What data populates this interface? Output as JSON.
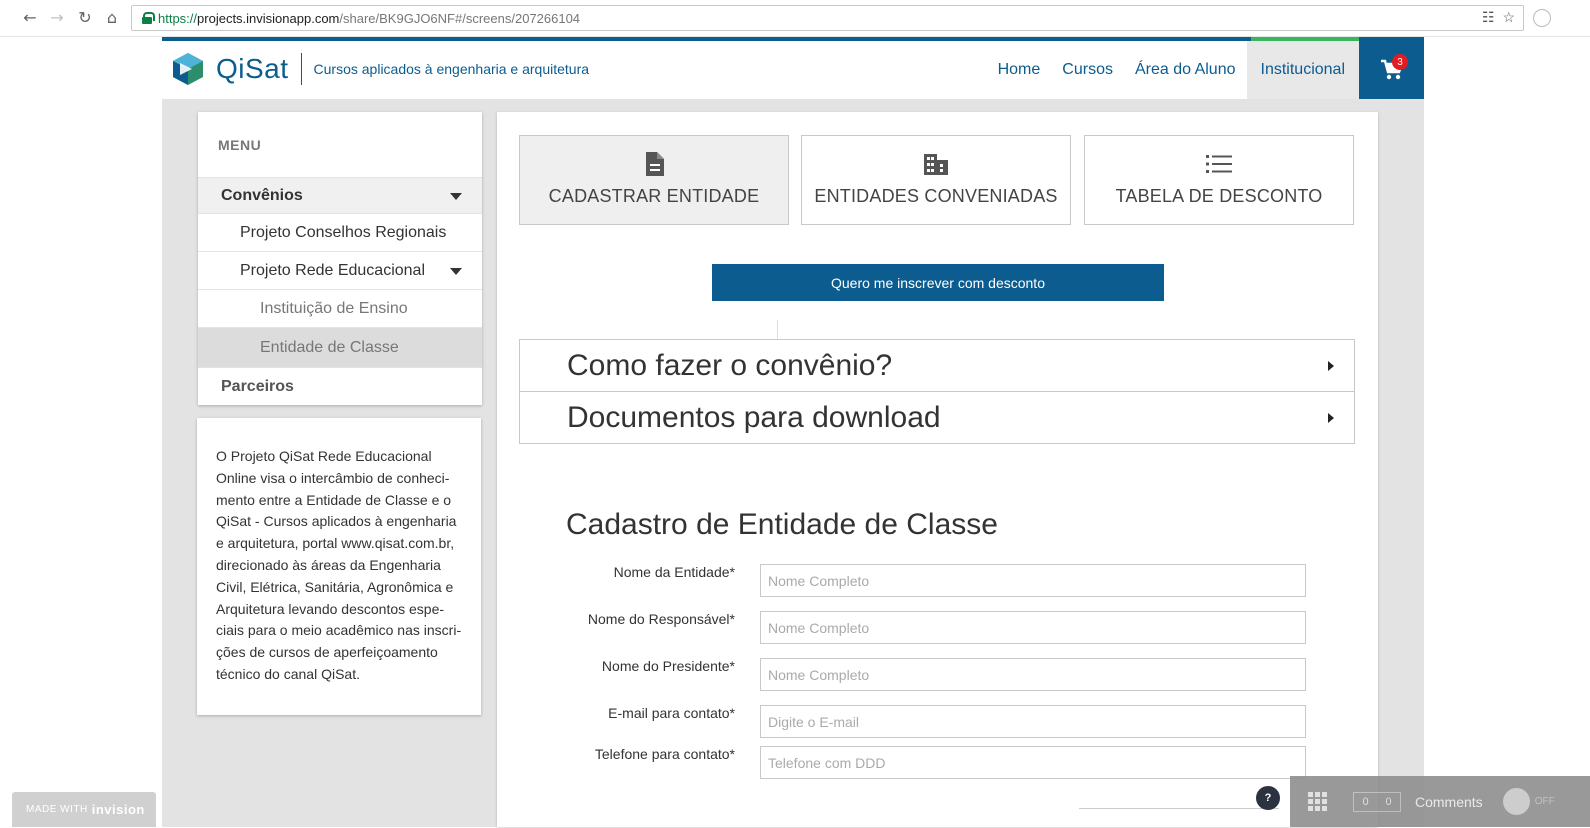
{
  "browser": {
    "url_protocol": "https://",
    "url_host": "projects.invisionapp.com",
    "url_path": "/share/BK9GJO6NF#/screens/207266104"
  },
  "header": {
    "logo_name": "QiSat",
    "tagline": "Cursos aplicados à engenharia e arquitetura",
    "nav": [
      {
        "label": "Home"
      },
      {
        "label": "Cursos"
      },
      {
        "label": "Área do Aluno"
      },
      {
        "label": "Institucional"
      }
    ],
    "cart_count": "3",
    "brand_color": "#0c5c8f",
    "accent_color": "#3bb55b"
  },
  "sidebar": {
    "menu_title": "MENU",
    "items": [
      {
        "label": "Convênios"
      },
      {
        "label": "Projeto Conselhos Regionais"
      },
      {
        "label": "Projeto Rede Educacional"
      },
      {
        "label": "Instituição de Ensino"
      },
      {
        "label": "Entidade de Classe"
      },
      {
        "label": "Parceiros"
      }
    ],
    "description": "O Projeto QiSat Rede Educacional Online visa o intercâmbio de conheci-mento entre a Entidade de Classe e o QiSat - Cursos aplicados à engenharia e arquitetura, portal www.qisat.com.br, direcionado às áreas da Engenharia Civil, Elétrica, Sanitária, Agronômica e Arquitetura levando descontos espe-ciais para o meio acadêmico nas inscri-ções de cursos de aperfeiçoamento técnico do canal QiSat."
  },
  "main": {
    "tiles": [
      {
        "label": "CADASTRAR ENTIDADE",
        "icon": "document-icon"
      },
      {
        "label": "ENTIDADES CONVENIADAS",
        "icon": "building-icon"
      },
      {
        "label": "TABELA DE DESCONTO",
        "icon": "list-icon"
      }
    ],
    "cta_label": "Quero me inscrever com desconto",
    "accordions": [
      {
        "label": "Como fazer o convênio?"
      },
      {
        "label": "Documentos para download"
      }
    ],
    "form": {
      "title": "Cadastro de Entidade de Classe",
      "fields": [
        {
          "label": "Nome da Entidade*",
          "placeholder": "Nome Completo"
        },
        {
          "label": "Nome do Responsável*",
          "placeholder": "Nome Completo"
        },
        {
          "label": "Nome do Presidente*",
          "placeholder": "Nome Completo"
        },
        {
          "label": "E-mail para contato*",
          "placeholder": "Digite o E-mail"
        },
        {
          "label": "Telefone para contato*",
          "placeholder": "Telefone com DDD"
        }
      ]
    }
  },
  "invision": {
    "made_with": "MADE WITH",
    "brand": "invision",
    "help": "?",
    "counter_a": "0",
    "counter_b": "0",
    "comments": "Comments",
    "toggle_state": "OFF"
  }
}
